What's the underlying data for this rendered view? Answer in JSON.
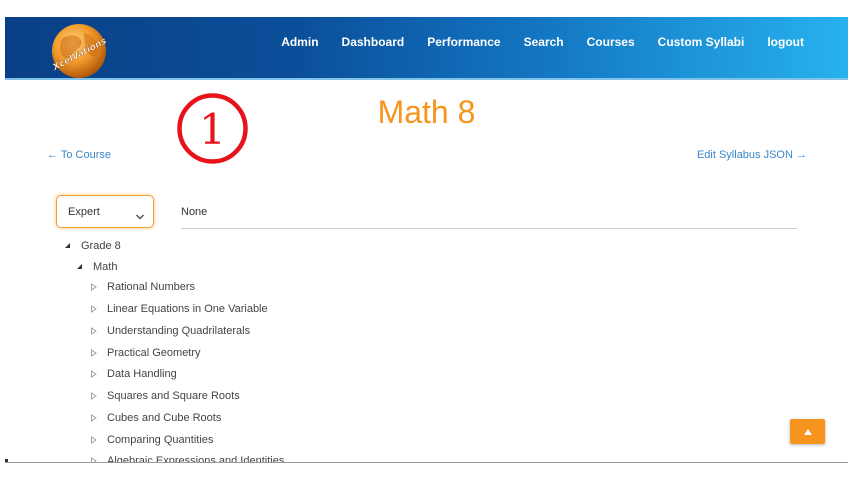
{
  "brand": {
    "logo_text": "XcelVations"
  },
  "nav": {
    "items": [
      {
        "label": "Admin"
      },
      {
        "label": "Dashboard"
      },
      {
        "label": "Performance"
      },
      {
        "label": "Search"
      },
      {
        "label": "Courses"
      },
      {
        "label": "Custom Syllabi"
      },
      {
        "label": "logout"
      }
    ]
  },
  "annotation": {
    "marker": "1"
  },
  "page": {
    "title": "Math 8",
    "back_link": "← To Course",
    "edit_link": "Edit Syllabus JSON →"
  },
  "level_select": {
    "value": "Expert"
  },
  "filter": {
    "value": "None"
  },
  "tree": {
    "root": {
      "label": "Grade 8",
      "expanded": true
    },
    "subject": {
      "label": "Math",
      "expanded": true
    },
    "chapters": [
      {
        "label": "Rational Numbers"
      },
      {
        "label": "Linear Equations in One Variable"
      },
      {
        "label": "Understanding Quadrilaterals"
      },
      {
        "label": "Practical Geometry"
      },
      {
        "label": "Data Handling"
      },
      {
        "label": "Squares and Square Roots"
      },
      {
        "label": "Cubes and Cube Roots"
      },
      {
        "label": "Comparing Quantities"
      },
      {
        "label": "Algebraic Expressions and Identities"
      }
    ]
  },
  "scroll_top": {
    "icon": "arrow-up-icon"
  },
  "colors": {
    "accent": "#f7941d",
    "link": "#3a86c8",
    "nav_dark": "#0a3f86",
    "nav_light": "#27b2ee",
    "annotation": "#e8121b"
  }
}
